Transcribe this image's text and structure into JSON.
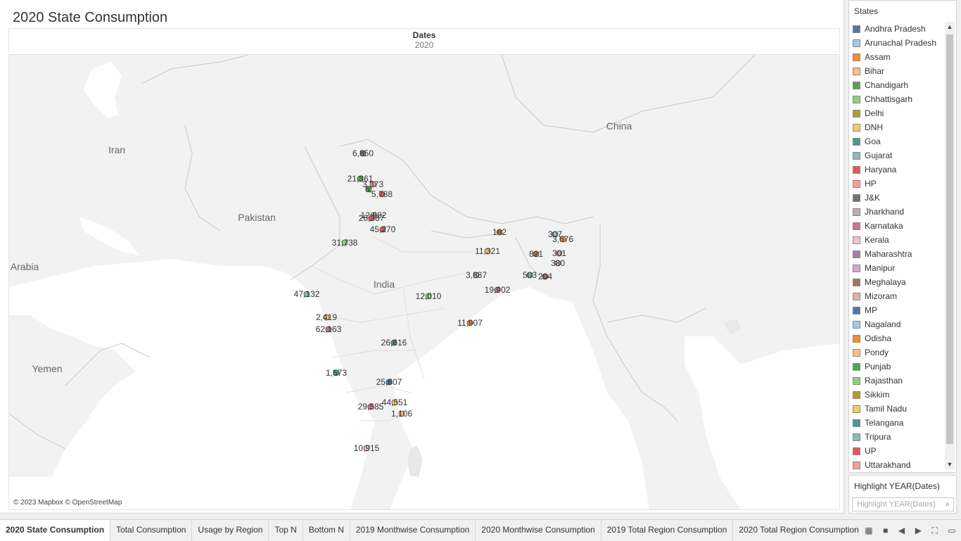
{
  "title": "2020 State Consumption",
  "dates_header": {
    "label": "Dates",
    "year": "2020"
  },
  "map": {
    "attribution": "© 2023 Mapbox © OpenStreetMap",
    "place_labels": [
      {
        "name": "China",
        "key": "china"
      },
      {
        "name": "Iran",
        "key": "iran"
      },
      {
        "name": "Pakistan",
        "key": "pakistan"
      },
      {
        "name": "India",
        "key": "india"
      },
      {
        "name": "Arabia",
        "key": "arabia"
      },
      {
        "name": "Yemen",
        "key": "yemen"
      }
    ],
    "points": [
      {
        "label": "6,850",
        "color": "#86807a"
      },
      {
        "label": "21,361",
        "color": "#59a14f"
      },
      {
        "label": "3,373",
        "color": "#ff9da7"
      },
      {
        "label": "6,",
        "color": "#59a14f"
      },
      {
        "label": "5,788",
        "color": "#e15759"
      },
      {
        "label": "12,882",
        "color": "#d4a6c8"
      },
      {
        "label": "26,387",
        "color": "#e15759"
      },
      {
        "label": "45,270",
        "color": "#e15759"
      },
      {
        "label": "31,738",
        "color": "#8cd17d"
      },
      {
        "label": "182",
        "color": "#b6992d"
      },
      {
        "label": "307",
        "color": "#a0cbe8"
      },
      {
        "label": "3,676",
        "color": "#f28e2b"
      },
      {
        "label": "11,321",
        "color": "#ffbe7d"
      },
      {
        "label": "821",
        "color": "#9d7660"
      },
      {
        "label": "301",
        "color": "#d4a6c8"
      },
      {
        "label": "380",
        "color": "#d7b5a6"
      },
      {
        "label": "3,887",
        "color": "#bab0ac"
      },
      {
        "label": "503",
        "color": "#86bcb6"
      },
      {
        "label": "204",
        "color": "#9d7660"
      },
      {
        "label": "19,902",
        "color": "#b07aa1"
      },
      {
        "label": "47,132",
        "color": "#86bcb6"
      },
      {
        "label": "12,010",
        "color": "#8cd17d"
      },
      {
        "label": "2,419",
        "color": "#f1ce63"
      },
      {
        "label": "62,163",
        "color": "#b07aa1"
      },
      {
        "label": "11,907",
        "color": "#f28e2b"
      },
      {
        "label": "26,616",
        "color": "#499894"
      },
      {
        "label": "1,573",
        "color": "#499894"
      },
      {
        "label": "25,607",
        "color": "#4e79a7"
      },
      {
        "label": "44,551",
        "color": "#f1ce63"
      },
      {
        "label": "29,585",
        "color": "#d37295"
      },
      {
        "label": "1,106",
        "color": "#ffbe7d"
      },
      {
        "label": "10,915",
        "color": "#fabfd2"
      }
    ]
  },
  "legend": {
    "title": "States",
    "items": [
      {
        "label": "Andhra Pradesh",
        "color": "#4e79a7"
      },
      {
        "label": "Arunachal Pradesh",
        "color": "#a0cbe8"
      },
      {
        "label": "Assam",
        "color": "#f28e2b"
      },
      {
        "label": "Bihar",
        "color": "#ffbe7d"
      },
      {
        "label": "Chandigarh",
        "color": "#59a14f"
      },
      {
        "label": "Chhattisgarh",
        "color": "#8cd17d"
      },
      {
        "label": "Delhi",
        "color": "#b6992d"
      },
      {
        "label": "DNH",
        "color": "#f1ce63"
      },
      {
        "label": "Goa",
        "color": "#499894"
      },
      {
        "label": "Gujarat",
        "color": "#86bcb6"
      },
      {
        "label": "Haryana",
        "color": "#e15759"
      },
      {
        "label": "HP",
        "color": "#ff9d9a"
      },
      {
        "label": "J&K",
        "color": "#79706e"
      },
      {
        "label": "Jharkhand",
        "color": "#bab0ac"
      },
      {
        "label": "Karnataka",
        "color": "#d37295"
      },
      {
        "label": "Kerala",
        "color": "#fabfd2"
      },
      {
        "label": "Maharashtra",
        "color": "#b07aa1"
      },
      {
        "label": "Manipur",
        "color": "#d4a6c8"
      },
      {
        "label": "Meghalaya",
        "color": "#9d7660"
      },
      {
        "label": "Mizoram",
        "color": "#d7b5a6"
      },
      {
        "label": "MP",
        "color": "#4e79a7"
      },
      {
        "label": "Nagaland",
        "color": "#a0cbe8"
      },
      {
        "label": "Odisha",
        "color": "#f28e2b"
      },
      {
        "label": "Pondy",
        "color": "#ffbe7d"
      },
      {
        "label": "Punjab",
        "color": "#59a14f"
      },
      {
        "label": "Rajasthan",
        "color": "#8cd17d"
      },
      {
        "label": "Sikkim",
        "color": "#b6992d"
      },
      {
        "label": "Tamil Nadu",
        "color": "#f1ce63"
      },
      {
        "label": "Telangana",
        "color": "#499894"
      },
      {
        "label": "Tripura",
        "color": "#86bcb6"
      },
      {
        "label": "UP",
        "color": "#e15759"
      },
      {
        "label": "Uttarakhand",
        "color": "#ff9d9a"
      }
    ]
  },
  "highlight": {
    "title": "Highlight YEAR(Dates)",
    "placeholder": "Highlight YEAR(Dates)"
  },
  "tabs": [
    {
      "label": "2020 State Consumption",
      "active": true
    },
    {
      "label": "Total Consumption"
    },
    {
      "label": "Usage by Region"
    },
    {
      "label": "Top N"
    },
    {
      "label": "Bottom N"
    },
    {
      "label": "2019 Monthwise Consumption"
    },
    {
      "label": "2020 Monthwise Consumption"
    },
    {
      "label": "2019 Total Region Consumption"
    },
    {
      "label": "2020 Total Region Consumption"
    }
  ]
}
